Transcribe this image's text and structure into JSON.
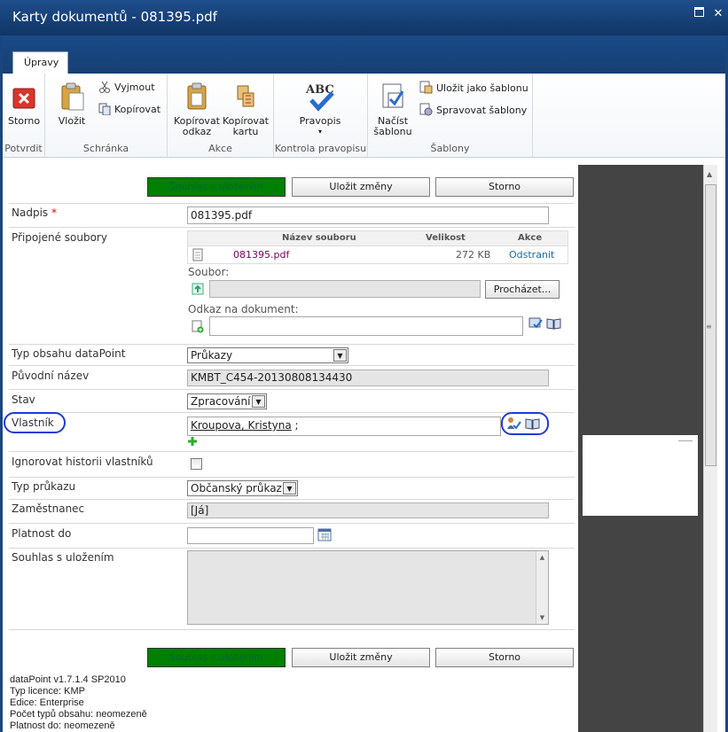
{
  "window": {
    "title": "Karty dokumentů - 081395.pdf"
  },
  "ribbon": {
    "tab_label": "Úpravy",
    "groups": {
      "potvrdit": {
        "label": "Potvrdit",
        "storno": "Storno"
      },
      "schranka": {
        "label": "Schránka",
        "vlozit": "Vložit",
        "vyjmout": "Vyjmout",
        "kopirovat": "Kopírovat"
      },
      "akce": {
        "label": "Akce",
        "kopirovat_odkaz_1": "Kopírovat",
        "kopirovat_odkaz_2": "odkaz",
        "kopirovat_kartu_1": "Kopírovat",
        "kopirovat_kartu_2": "kartu"
      },
      "pravopis": {
        "label": "Kontrola pravopisu",
        "pravopis": "Pravopis",
        "icon_text": "ABC"
      },
      "sablony": {
        "label": "Šablony",
        "nacist_1": "Načíst",
        "nacist_2": "šablonu",
        "ulozit_jako": "Uložit jako šablonu",
        "spravovat": "Spravovat šablony"
      }
    }
  },
  "buttons": {
    "souhlas": "Souhlas s uložením",
    "ulozit": "Uložit změny",
    "storno": "Storno"
  },
  "form": {
    "nadpis": {
      "label": "Nadpis",
      "required_mark": "*",
      "value": "081395.pdf"
    },
    "pripojene": {
      "label": "Připojené soubory",
      "columns": {
        "nazev": "Název souboru",
        "velikost": "Velikost",
        "akce": "Akce"
      },
      "files": [
        {
          "name": "081395.pdf",
          "size": "272 KB",
          "action": "Odstranit"
        }
      ],
      "soubor_label": "Soubor:",
      "prochazet": "Procházet...",
      "odkaz_label": "Odkaz na dokument:"
    },
    "typ_obsahu": {
      "label": "Typ obsahu dataPoint",
      "value": "Průkazy"
    },
    "puvodni_nazev": {
      "label": "Původní název",
      "value": "KMBT_C454-20130808134430"
    },
    "stav": {
      "label": "Stav",
      "value": "Zpracování"
    },
    "vlastnik": {
      "label": "Vlastník",
      "value": "Kroupova, Kristyna",
      "separator": ";"
    },
    "ignorovat": {
      "label": "Ignorovat historii vlastníků"
    },
    "typ_prukazu": {
      "label": "Typ průkazu",
      "value": "Občanský průkaz"
    },
    "zamestnanec": {
      "label": "Zaměstnanec",
      "value": "[Já]"
    },
    "platnost": {
      "label": "Platnost do",
      "value": ""
    },
    "souhlas": {
      "label": "Souhlas s uložením"
    }
  },
  "footer": {
    "line1": "dataPoint v1.7.1.4 SP2010",
    "line2": "Typ licence: KMP",
    "line3": "Edice: Enterprise",
    "line4": "Počet typů obsahu: neomezeně",
    "line5": "Platnost do: neomezeně"
  },
  "colors": {
    "titlebar": "#1a467f",
    "green_button": "#008000",
    "highlight_circle": "#1e3bd6"
  }
}
